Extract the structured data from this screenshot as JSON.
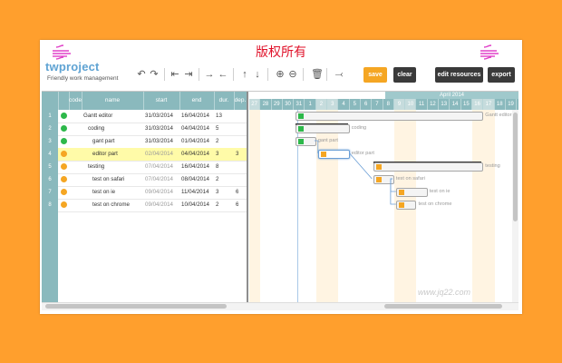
{
  "banner": {
    "text": "版权所有"
  },
  "logo": {
    "title": "twproject",
    "subtitle": "Friendly work management"
  },
  "toolbar": {
    "icons": [
      "undo-icon",
      "redo-icon",
      "indent-left-icon",
      "indent-right-icon",
      "move-right-icon",
      "move-left-icon",
      "move-up-icon",
      "move-down-icon",
      "zoom-in-icon",
      "zoom-out-icon",
      "delete-icon",
      "link-icon"
    ],
    "save_label": "save",
    "clear_label": "clear",
    "resources_label": "edit resources",
    "export_label": "export"
  },
  "table": {
    "headers": [
      "code",
      "name",
      "start",
      "end",
      "dur.",
      "dep."
    ],
    "rows": [
      {
        "num": "1",
        "status": "#2db84a",
        "name": "Gantt editor",
        "start": "31/03/2014",
        "end": "16/04/2014",
        "dur": "13",
        "dep": "",
        "level": 0,
        "dim": false
      },
      {
        "num": "2",
        "status": "#2db84a",
        "name": "coding",
        "start": "31/03/2014",
        "end": "04/04/2014",
        "dur": "5",
        "dep": "",
        "level": 1,
        "dim": false
      },
      {
        "num": "3",
        "status": "#2db84a",
        "name": "gant part",
        "start": "31/03/2014",
        "end": "01/04/2014",
        "dur": "2",
        "dep": "",
        "level": 2,
        "dim": false
      },
      {
        "num": "4",
        "status": "#f5a623",
        "name": "editor part",
        "start": "02/04/2014",
        "end": "04/04/2014",
        "dur": "3",
        "dep": "3",
        "level": 2,
        "dim": true,
        "selected": true
      },
      {
        "num": "5",
        "status": "#f5a623",
        "name": "testing",
        "start": "07/04/2014",
        "end": "16/04/2014",
        "dur": "8",
        "dep": "",
        "level": 1,
        "dim": true
      },
      {
        "num": "6",
        "status": "#f5a623",
        "name": "test on safari",
        "start": "07/04/2014",
        "end": "08/04/2014",
        "dur": "2",
        "dep": "",
        "level": 2,
        "dim": true
      },
      {
        "num": "7",
        "status": "#f5a623",
        "name": "test on ie",
        "start": "09/04/2014",
        "end": "11/04/2014",
        "dur": "3",
        "dep": "6",
        "level": 2,
        "dim": true
      },
      {
        "num": "8",
        "status": "#f5a623",
        "name": "test on chrome",
        "start": "09/04/2014",
        "end": "10/04/2014",
        "dur": "2",
        "dep": "6",
        "level": 2,
        "dim": true
      }
    ]
  },
  "gantt": {
    "month": "April 2014",
    "days": [
      "27",
      "28",
      "29",
      "30",
      "31",
      "1",
      "2",
      "3",
      "4",
      "5",
      "6",
      "7",
      "8",
      "9",
      "10",
      "11",
      "12",
      "13",
      "14",
      "15",
      "16",
      "17",
      "18",
      "19"
    ],
    "bar_labels": [
      "Gantt editor",
      "coding",
      "gant part",
      "editor part",
      "testing",
      "test on safari",
      "test on ie",
      "test on chrome"
    ]
  },
  "watermark": "www.jq22.com",
  "colors": {
    "header": "#8ab9bd",
    "accent": "#f5a623",
    "done": "#2db84a",
    "active": "#f5a623",
    "selected_row": "#fffba8"
  }
}
